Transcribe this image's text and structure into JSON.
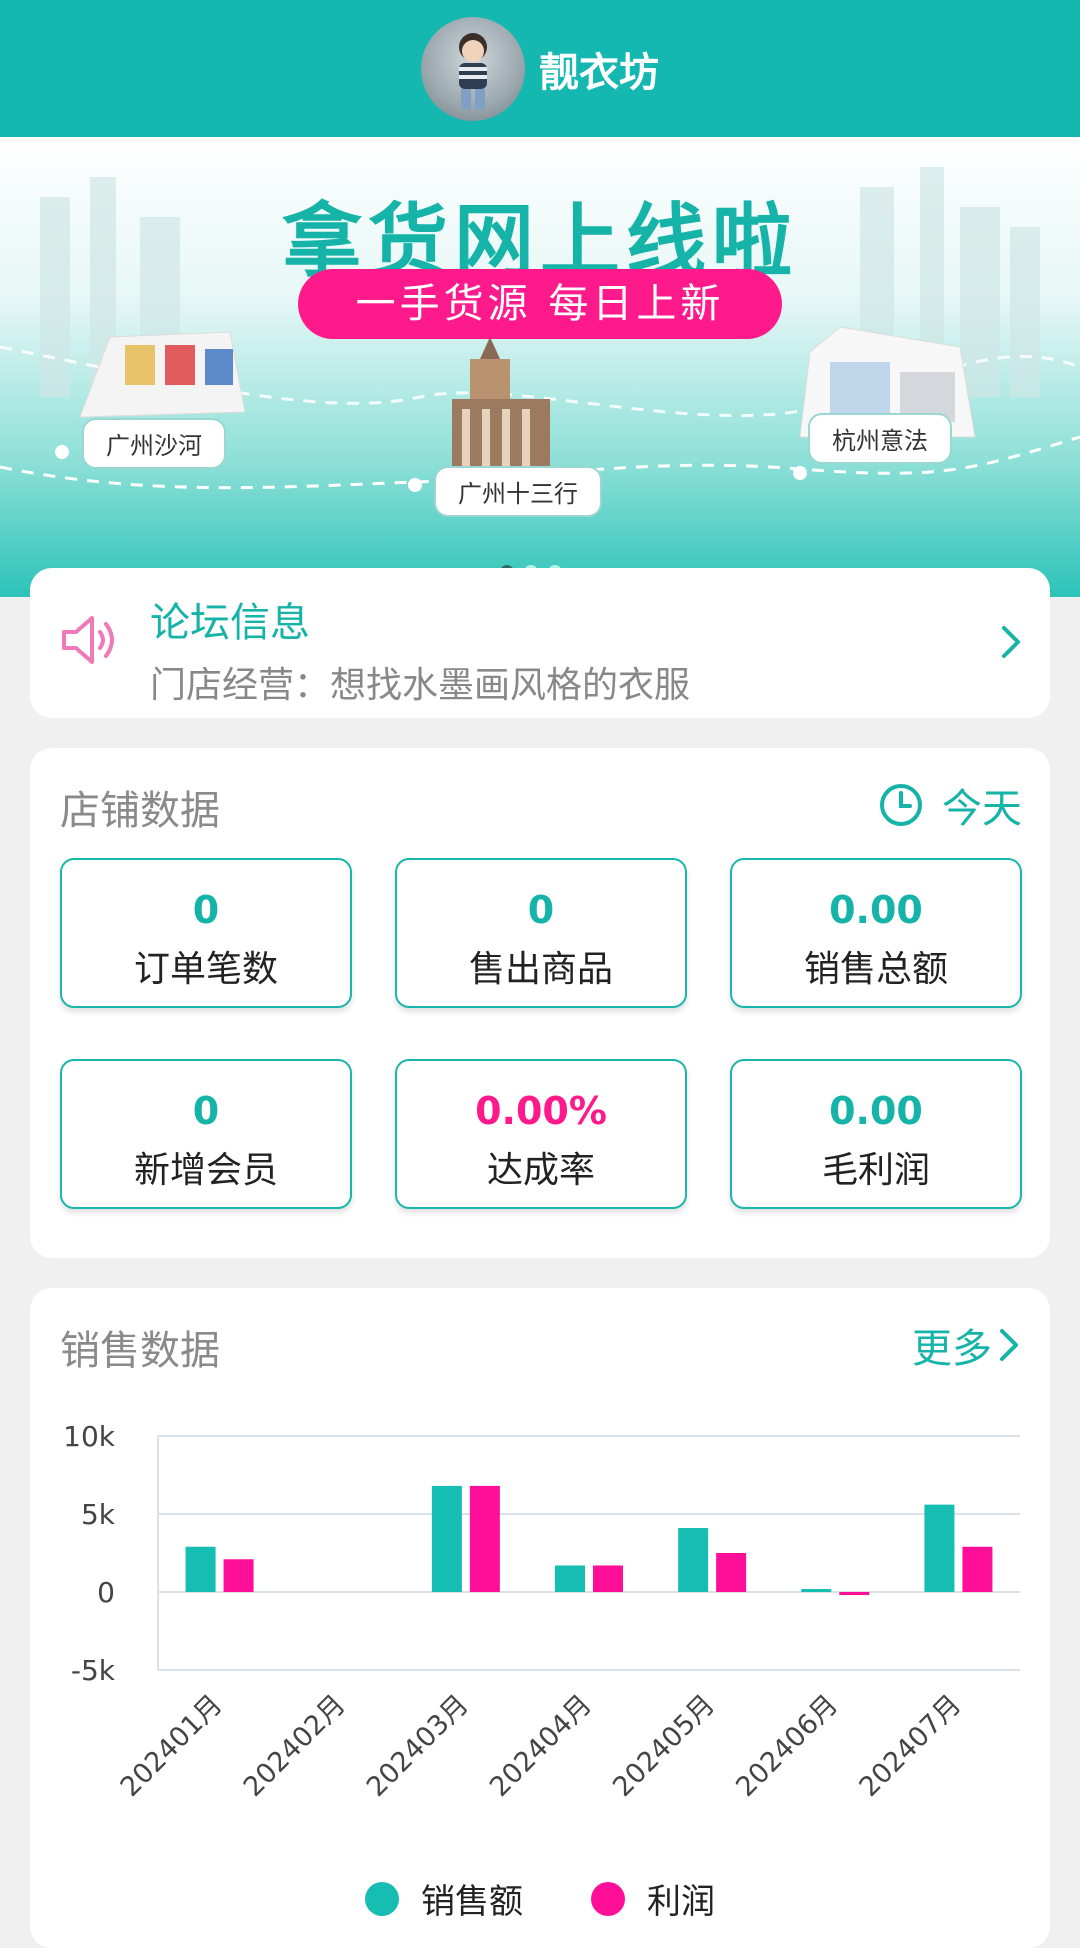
{
  "header": {
    "shop_name": "靓衣坊"
  },
  "banner": {
    "title": "拿货网上线啦",
    "subtitle": "一手货源 每日上新",
    "locations": [
      "广州沙河",
      "广州十三行",
      "杭州意法"
    ]
  },
  "forum": {
    "title": "论坛信息",
    "text": "门店经营：想找水墨画风格的衣服"
  },
  "shop_data": {
    "title": "店铺数据",
    "period": "今天",
    "stats": [
      {
        "value": "0",
        "label": "订单笔数"
      },
      {
        "value": "0",
        "label": "售出商品"
      },
      {
        "value": "0.00",
        "label": "销售总额"
      },
      {
        "value": "0",
        "label": "新增会员"
      },
      {
        "value": "0.00%",
        "label": "达成率"
      },
      {
        "value": "0.00",
        "label": "毛利润"
      }
    ]
  },
  "sales_data": {
    "title": "销售数据",
    "more": "更多"
  },
  "colors": {
    "primary": "#14b8b0",
    "accent": "#ff1a8c"
  },
  "chart_data": {
    "type": "bar",
    "categories": [
      "202401月",
      "202402月",
      "202403月",
      "202404月",
      "202405月",
      "202406月",
      "202407月"
    ],
    "series": [
      {
        "name": "销售额",
        "color": "#16bdb2",
        "values": [
          2900,
          0,
          6800,
          1700,
          4100,
          150,
          5600
        ]
      },
      {
        "name": "利润",
        "color": "#ff0f98",
        "values": [
          2100,
          0,
          6800,
          1700,
          2500,
          -150,
          2900
        ]
      }
    ],
    "yticks": [
      "10k",
      "5k",
      "0",
      "-5k"
    ],
    "ylim": [
      -5000,
      10000
    ],
    "legend": "bottom"
  }
}
